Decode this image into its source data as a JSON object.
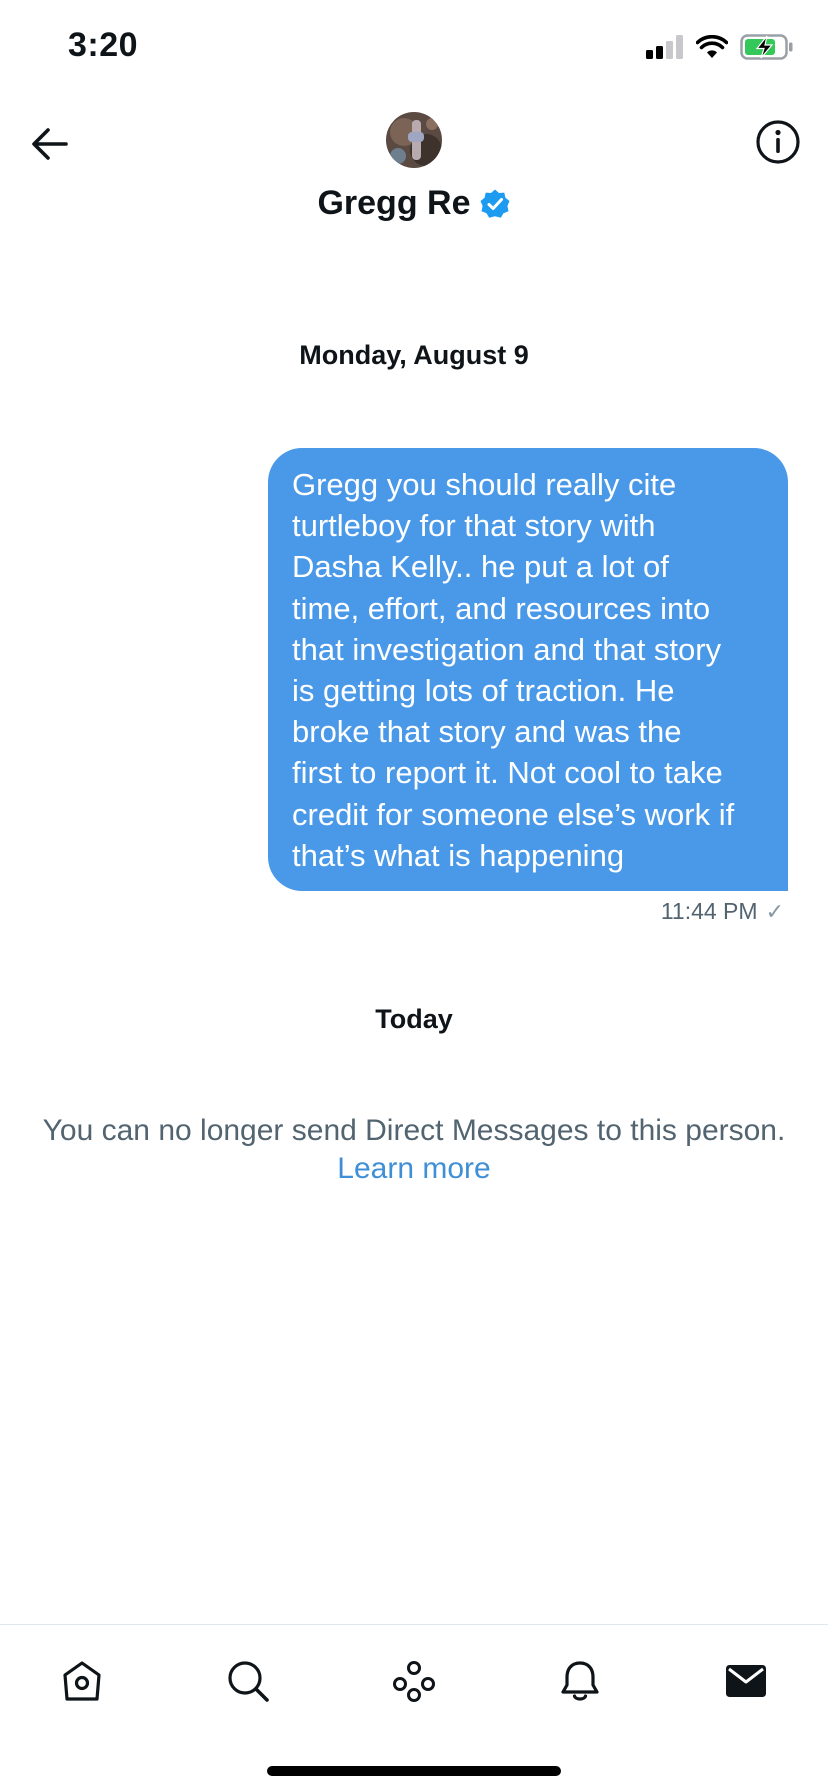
{
  "status_bar": {
    "time": "3:20",
    "icons": [
      "signal-icon",
      "wifi-icon",
      "battery-charging-icon"
    ]
  },
  "header": {
    "back_icon": "arrow-left-icon",
    "contact_name": "Gregg Re",
    "verified_icon": "verified-badge-icon",
    "info_icon": "info-circle-icon"
  },
  "conversation": {
    "date_separator_1": "Monday, August 9",
    "message": {
      "lines": [
        "Gregg you should really cite",
        "turtleboy for that story with",
        "Dasha Kelly.. he put a lot of",
        "time, effort, and resources into",
        "that investigation and that story",
        "is getting lots of traction. He",
        "broke that story and was the",
        "first to report it. Not cool to take",
        "credit for someone else’s work if",
        "that’s what is happening"
      ],
      "time": "11:44 PM",
      "status_icon": "sent-check-icon"
    },
    "date_separator_2": "Today",
    "notice": "You can no longer send Direct Messages to this person.",
    "learn_more": "Learn more"
  },
  "tab_bar": {
    "items": [
      {
        "icon": "home-icon"
      },
      {
        "icon": "search-icon"
      },
      {
        "icon": "spaces-icon"
      },
      {
        "icon": "bell-icon"
      },
      {
        "icon": "mail-icon",
        "active": true
      }
    ]
  },
  "colors": {
    "bubble": "#4a99e9",
    "link": "#3f8fd6",
    "secondary_text": "#536471",
    "verified": "#1d9bf0"
  }
}
